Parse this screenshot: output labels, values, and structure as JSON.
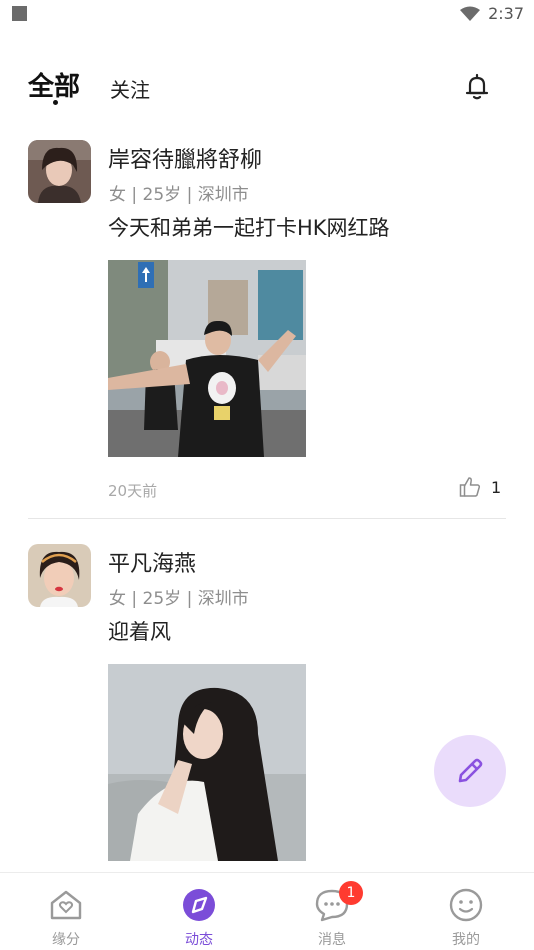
{
  "status_bar": {
    "time": "2:37"
  },
  "header": {
    "tab_all": "全部",
    "tab_follow": "关注"
  },
  "posts": [
    {
      "name": "岸容待臘將舒柳",
      "meta": "女 | 25岁 | 深圳市",
      "content": "今天和弟弟一起打卡HK网红路",
      "time": "20天前",
      "likes": "1"
    },
    {
      "name": "平凡海燕",
      "meta": "女 | 25岁 | 深圳市",
      "content": "迎着风"
    }
  ],
  "bottom_nav": [
    {
      "label": "缘分"
    },
    {
      "label": "动态"
    },
    {
      "label": "消息",
      "badge": "1"
    },
    {
      "label": "我的"
    }
  ],
  "colors": {
    "accent": "#7b4dd8",
    "fab_bg": "#eadcfb",
    "badge": "#ff3b30"
  }
}
